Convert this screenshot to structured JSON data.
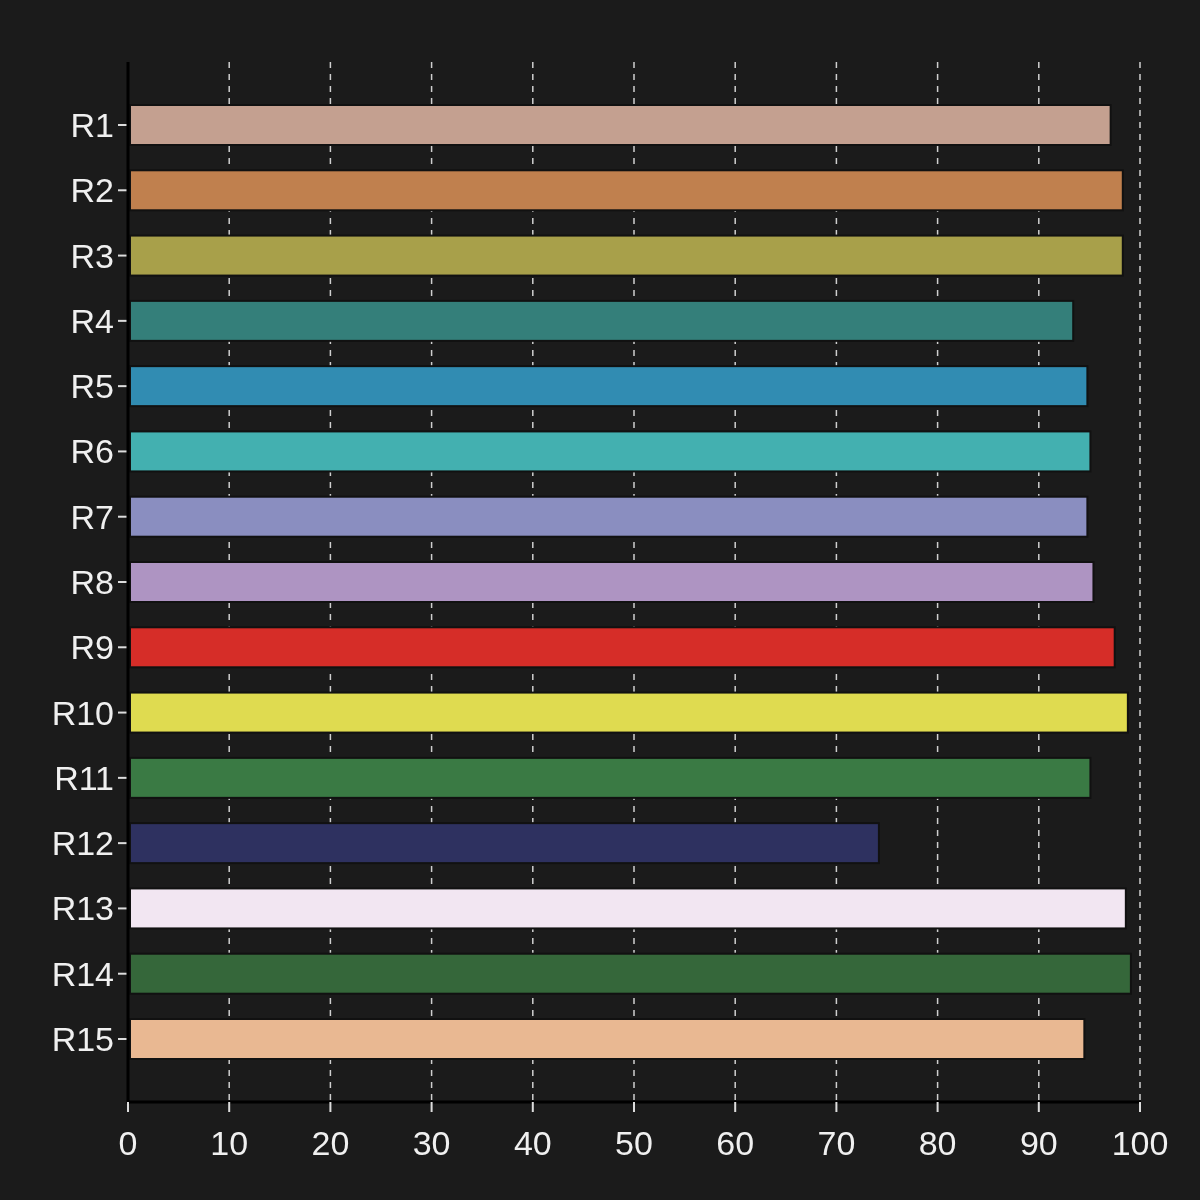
{
  "chart": {
    "chart_data": {
      "type": "bar",
      "orientation": "horizontal",
      "categories": [
        "R1",
        "R2",
        "R3",
        "R4",
        "R5",
        "R6",
        "R7",
        "R8",
        "R9",
        "R10",
        "R11",
        "R12",
        "R13",
        "R14",
        "R15"
      ],
      "values": [
        97.1,
        98.3,
        98.3,
        93.4,
        94.8,
        95.1,
        94.8,
        95.4,
        97.5,
        98.8,
        95.1,
        74.2,
        98.6,
        99.1,
        94.5
      ],
      "colors": [
        "#c4a090",
        "#c0804e",
        "#a8a04a",
        "#347f7a",
        "#318cb2",
        "#43b0b0",
        "#8a8ec0",
        "#ae94c2",
        "#d62d28",
        "#dfdb50",
        "#3a7a44",
        "#2e3160",
        "#f2e6f2",
        "#35673a",
        "#e9b892"
      ],
      "xlim": [
        0,
        100
      ],
      "grid": true,
      "xticks": [
        0,
        10,
        20,
        30,
        40,
        50,
        60,
        70,
        80,
        90,
        100
      ]
    }
  }
}
